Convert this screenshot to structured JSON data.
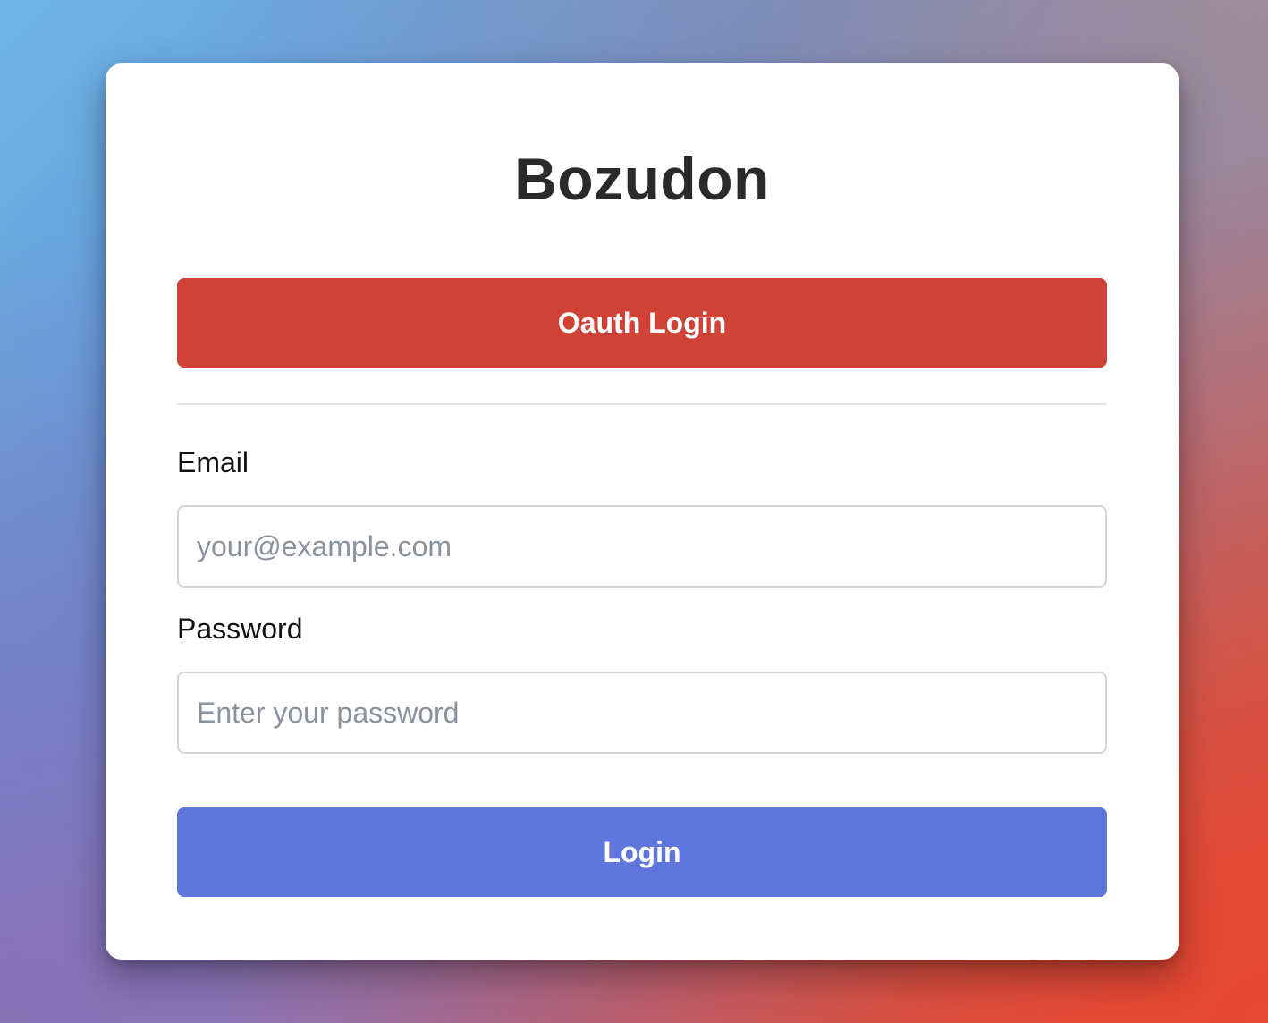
{
  "app": {
    "title": "Bozudon"
  },
  "oauth_button": {
    "label": "Oauth Login"
  },
  "form": {
    "email": {
      "label": "Email",
      "value": "",
      "placeholder": "your@example.com"
    },
    "password": {
      "label": "Password",
      "value": "",
      "placeholder": "Enter your password"
    },
    "submit": {
      "label": "Login"
    }
  },
  "colors": {
    "oauth_button": "#d14236",
    "login_button": "#5f76dc",
    "title_text": "#2a2a2a",
    "placeholder_text": "#8b929c"
  }
}
